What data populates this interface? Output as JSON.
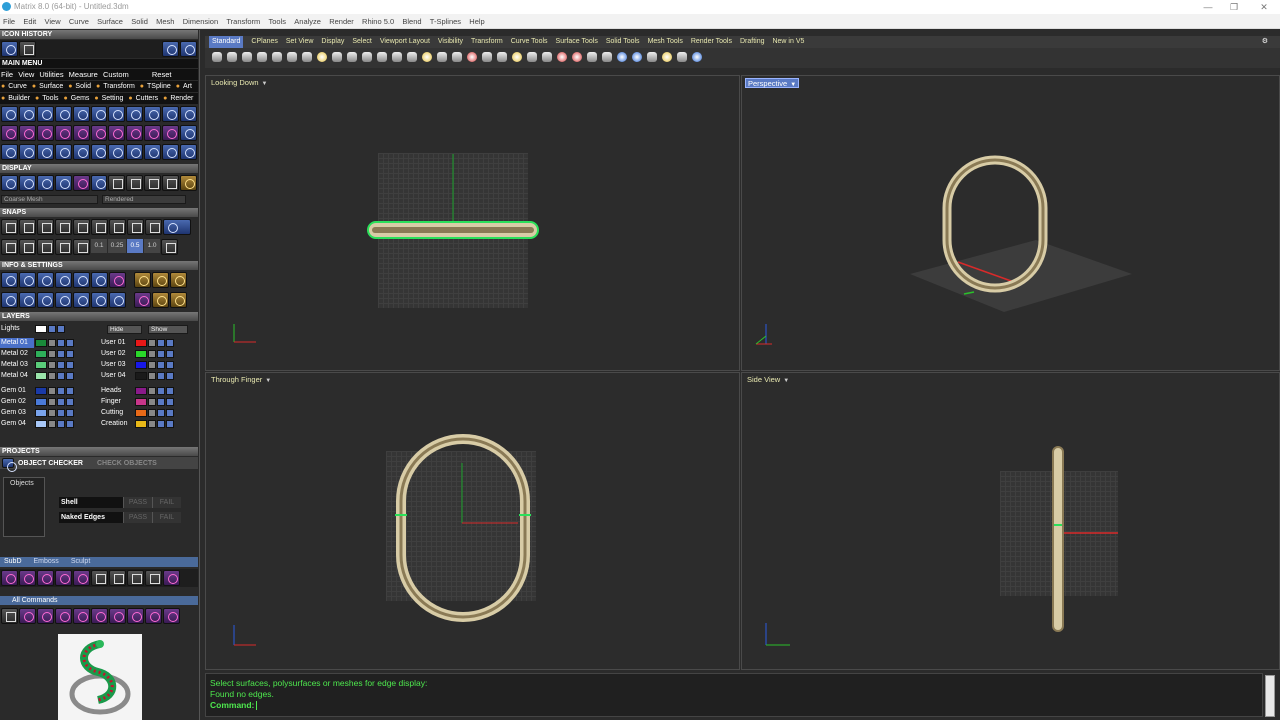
{
  "window": {
    "title": "Matrix 8.0 (64-bit) - Untitled.3dm"
  },
  "menubar": [
    "File",
    "Edit",
    "View",
    "Curve",
    "Surface",
    "Solid",
    "Mesh",
    "Dimension",
    "Transform",
    "Tools",
    "Analyze",
    "Render",
    "Rhino 5.0",
    "Blend",
    "T-Splines",
    "Help"
  ],
  "left": {
    "icon_history": "ICON HISTORY",
    "main_menu": "MAIN MENU",
    "main_menu_items": [
      "File",
      "View",
      "Utilities",
      "Measure",
      "Custom"
    ],
    "reset": "Reset",
    "builder_line1": [
      "Curve",
      "Surface",
      "Solid",
      "Transform",
      "TSpline",
      "Art"
    ],
    "builder_line2": [
      "Builder",
      "Tools",
      "Gems",
      "Setting",
      "Cutters",
      "Render"
    ],
    "display": "DISPLAY",
    "display_fields": [
      "Coarse Mesh",
      "Rendered"
    ],
    "snaps": "SNAPS",
    "snap_values": [
      "0.1",
      "0.25",
      "0.5",
      "1.0"
    ],
    "info_settings": "INFO & SETTINGS",
    "layers": "LAYERS",
    "lights": "Lights",
    "hide": "Hide",
    "show": "Show",
    "layers_left": [
      {
        "name": "Metal 01",
        "color": "#1a8a3a"
      },
      {
        "name": "Metal 02",
        "color": "#2eb05a"
      },
      {
        "name": "Metal 03",
        "color": "#5acc7a"
      },
      {
        "name": "Metal 04",
        "color": "#9ae4aa"
      },
      {
        "name": "Gem 01",
        "color": "#1a3aa8"
      },
      {
        "name": "Gem 02",
        "color": "#4a7ad8"
      },
      {
        "name": "Gem 03",
        "color": "#7aa4ec"
      },
      {
        "name": "Gem 04",
        "color": "#a8c8f8"
      }
    ],
    "layers_right": [
      {
        "name": "User 01",
        "color": "#e81818"
      },
      {
        "name": "User 02",
        "color": "#2ad82a"
      },
      {
        "name": "User 03",
        "color": "#1818e8"
      },
      {
        "name": "User 04",
        "color": "#1a1a1a"
      },
      {
        "name": "Heads",
        "color": "#8a1a8a"
      },
      {
        "name": "Finger",
        "color": "#c8368a"
      },
      {
        "name": "Cutting",
        "color": "#e86a18"
      },
      {
        "name": "Creation",
        "color": "#e8b818"
      }
    ],
    "projects": "PROJECTS",
    "object_checker": "OBJECT CHECKER",
    "check_objects": "CHECK OBJECTS",
    "objects": "Objects",
    "checks": [
      {
        "name": "Shell",
        "pass": "PASS",
        "fail": "FAIL"
      },
      {
        "name": "Naked Edges",
        "pass": "PASS",
        "fail": "FAIL"
      }
    ],
    "tabs": [
      "SubD",
      "Emboss",
      "Sculpt"
    ],
    "all_commands": "All Commands"
  },
  "toolbar_tabs": [
    "Standard",
    "CPlanes",
    "Set View",
    "Display",
    "Select",
    "Viewport Layout",
    "Visibility",
    "Transform",
    "Curve Tools",
    "Surface Tools",
    "Solid Tools",
    "Mesh Tools",
    "Render Tools",
    "Drafting",
    "New in V5"
  ],
  "viewports": {
    "top_left": "Looking Down",
    "top_right": "Perspective",
    "bottom_left": "Through Finger",
    "bottom_right": "Side View"
  },
  "command": {
    "line1": "Select surfaces, polysurfaces or meshes for edge display:",
    "line2": "Found no edges.",
    "prompt": "Command:"
  },
  "colors": {
    "accent": "#5a7ac4",
    "command_text": "#4ee84e",
    "viewport_label": "#e8e8b0",
    "metal": "#c9b98a"
  }
}
